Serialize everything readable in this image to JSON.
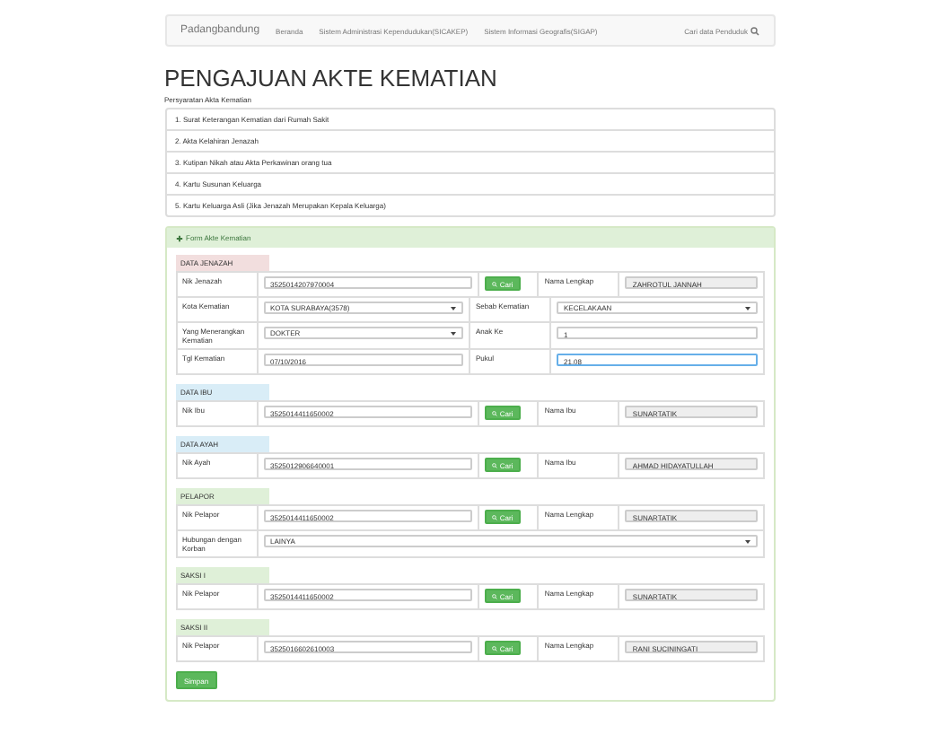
{
  "navbar": {
    "brand": "Padangbandung",
    "links": [
      "Beranda",
      "Sistem Administrasi Kependudukan(SICAKEP)",
      "Sistem Informasi Geografis(SIGAP)"
    ],
    "search": "Cari data Penduduk"
  },
  "title": "PENGAJUAN AKTE KEMATIAN",
  "requirements_label": "Persyaratan Akta Kematian",
  "requirements": [
    "1. Surat Keterangan Kematian dari Rumah Sakit",
    "2. Akta Kelahiran Jenazah",
    "3. Kutipan Nikah atau Akta Perkawinan orang tua",
    "4. Kartu Susunan Keluarga",
    "5. Kartu Keluarga Asli (Jika Jenazah Merupakan Kepala Keluarga)"
  ],
  "form_title": "Form Akte Kematian",
  "sections": [
    {
      "title": "DATA JENAZAH",
      "color": "#f2dede",
      "rows": [
        [
          {
            "kind": "label",
            "text": "Nik Jenazah"
          },
          {
            "kind": "input",
            "value": "3525014207970004",
            "focused": false
          },
          {
            "kind": "button",
            "text": "Cari"
          },
          {
            "kind": "label",
            "text": "Nama Lengkap"
          },
          {
            "kind": "readonly",
            "value": "ZAHROTUL JANNAH"
          }
        ],
        [
          {
            "kind": "label",
            "text": "Kota Kematian"
          },
          {
            "kind": "select",
            "value": "KOTA SURABAYA(3578)"
          },
          {
            "kind": "label",
            "text": "Sebab Kematian"
          },
          {
            "kind": "select",
            "value": "KECELAKAAN"
          }
        ],
        [
          {
            "kind": "label",
            "text": "Yang Menerangkan Kematian"
          },
          {
            "kind": "select",
            "value": "DOKTER"
          },
          {
            "kind": "label",
            "text": "Anak Ke"
          },
          {
            "kind": "input",
            "value": "1",
            "focused": false
          }
        ],
        [
          {
            "kind": "label",
            "text": "Tgl Kematian"
          },
          {
            "kind": "input",
            "value": "07/10/2016",
            "focused": false
          },
          {
            "kind": "label",
            "text": "Pukul"
          },
          {
            "kind": "input",
            "value": "21.08",
            "focused": true
          }
        ]
      ]
    },
    {
      "title": "DATA IBU",
      "color": "#d9edf7",
      "rows": [
        [
          {
            "kind": "label",
            "text": "Nik Ibu"
          },
          {
            "kind": "input",
            "value": "3525014411650002",
            "focused": false
          },
          {
            "kind": "button",
            "text": "Cari"
          },
          {
            "kind": "label",
            "text": "Nama Ibu"
          },
          {
            "kind": "readonly",
            "value": "SUNARTATIK"
          }
        ]
      ]
    },
    {
      "title": "DATA AYAH",
      "color": "#d9edf7",
      "rows": [
        [
          {
            "kind": "label",
            "text": "Nik Ayah"
          },
          {
            "kind": "input",
            "value": "3525012906640001",
            "focused": false
          },
          {
            "kind": "button",
            "text": "Cari"
          },
          {
            "kind": "label",
            "text": "Nama Ibu"
          },
          {
            "kind": "readonly",
            "value": "AHMAD HIDAYATULLAH"
          }
        ]
      ]
    },
    {
      "title": "PELAPOR",
      "color": "#dff0d8",
      "rows": [
        [
          {
            "kind": "label",
            "text": "Nik Pelapor"
          },
          {
            "kind": "input",
            "value": "3525014411650002",
            "focused": false
          },
          {
            "kind": "button",
            "text": "Cari"
          },
          {
            "kind": "label",
            "text": "Nama Lengkap"
          },
          {
            "kind": "readonly",
            "value": "SUNARTATIK"
          }
        ],
        [
          {
            "kind": "label",
            "text": "Hubungan dengan Korban"
          },
          {
            "kind": "select",
            "value": "LAINYA"
          }
        ]
      ]
    },
    {
      "title": "SAKSI I",
      "color": "#dff0d8",
      "rows": [
        [
          {
            "kind": "label",
            "text": "Nik Pelapor"
          },
          {
            "kind": "input",
            "value": "3525014411650002",
            "focused": false
          },
          {
            "kind": "button",
            "text": "Cari"
          },
          {
            "kind": "label",
            "text": "Nama Lengkap"
          },
          {
            "kind": "readonly",
            "value": "SUNARTATIK"
          }
        ]
      ]
    },
    {
      "title": "SAKSI II",
      "color": "#dff0d8",
      "rows": [
        [
          {
            "kind": "label",
            "text": "Nik Pelapor"
          },
          {
            "kind": "input",
            "value": "3525016602610003",
            "focused": false
          },
          {
            "kind": "button",
            "text": "Cari"
          },
          {
            "kind": "label",
            "text": "Nama Lengkap"
          },
          {
            "kind": "readonly",
            "value": "RANI SUCININGATI"
          }
        ]
      ]
    }
  ],
  "submit": "Simpan"
}
